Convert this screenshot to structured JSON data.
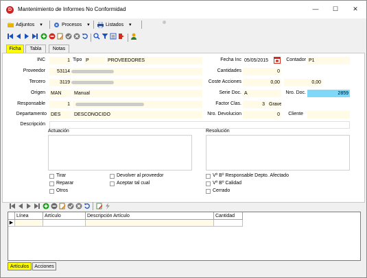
{
  "window": {
    "title": "Mantenimiento de Informes No Conformidad",
    "app_icon_letter": "D",
    "minimize": "—",
    "maximize": "☐",
    "close": "✕"
  },
  "menubar": {
    "items": [
      {
        "label": "Adjuntos",
        "icon": "paperclip-icon"
      },
      {
        "label": "Procesos",
        "icon": "gears-icon"
      },
      {
        "label": "Listados",
        "icon": "printer-icon"
      }
    ],
    "dropdown_glyph": "▾"
  },
  "tabs": {
    "ficha": "Ficha",
    "tabla": "Tabla",
    "notas": "Notas"
  },
  "form": {
    "inc_label": "INC",
    "inc_value": "1",
    "tipo_label": "Tipo",
    "tipo_code": "P",
    "tipo_name": "PROVEEDORES",
    "fecha_label": "Fecha Inc",
    "fecha_value": "05/05/2015",
    "contador_label": "Contador",
    "contador_value": "P1",
    "proveedor_label": "Proveedor",
    "proveedor_code": "53114",
    "cantidades_label": "Cantidades",
    "cantidades_value": "0",
    "tercero_label": "Tercero",
    "tercero_code": "3119",
    "coste_label": "Coste Acciones",
    "coste_value1": "0,00",
    "coste_value2": "0,00",
    "origen_label": "Origen",
    "origen_code": "MAN",
    "origen_name": "Manual",
    "serie_label": "Serie Doc.",
    "serie_value": "A",
    "nrodoc_label": "Nro. Doc.",
    "nrodoc_value": "2859",
    "responsable_label": "Responsable",
    "responsable_code": "1",
    "factor_label": "Factor Clas.",
    "factor_value": "3",
    "factor_name": "Grave",
    "departamento_label": "Departamento",
    "departamento_code": "DES",
    "departamento_name": "DESCONOCIDO",
    "nrodev_label": "Nro. Devolucion",
    "nrodev_value": "0",
    "cliente_label": "Cliente",
    "descripcion_label": "Descripción",
    "actuacion_label": "Actuación",
    "resolucion_label": "Resolución"
  },
  "checkboxes": {
    "tirar": "Tirar",
    "reparar": "Reparar",
    "otros": "Otros",
    "devolver": "Devolver al proveedor",
    "aceptar": "Aceptar tal cual",
    "vb_responsable": "Vº Bº Responsable Depto. Afectado",
    "vb_calidad": "Vº Bº Calidad",
    "cerrado": "Cerrado"
  },
  "grid": {
    "columns": [
      "Línea",
      "Artículo",
      "Descripción Artículo",
      "Cantidad"
    ],
    "row_marker": "▶"
  },
  "bottom_tabs": {
    "articulos": "Artículos",
    "acciones": "Acciones"
  },
  "colors": {
    "active_tab": "#ffff00",
    "field_bg": "#fffbe6",
    "nro_doc_bg": "#80d8f8",
    "nav_blue": "#1a4fc0",
    "add_green": "#1ea01e",
    "delete_red": "#d42a1e"
  }
}
